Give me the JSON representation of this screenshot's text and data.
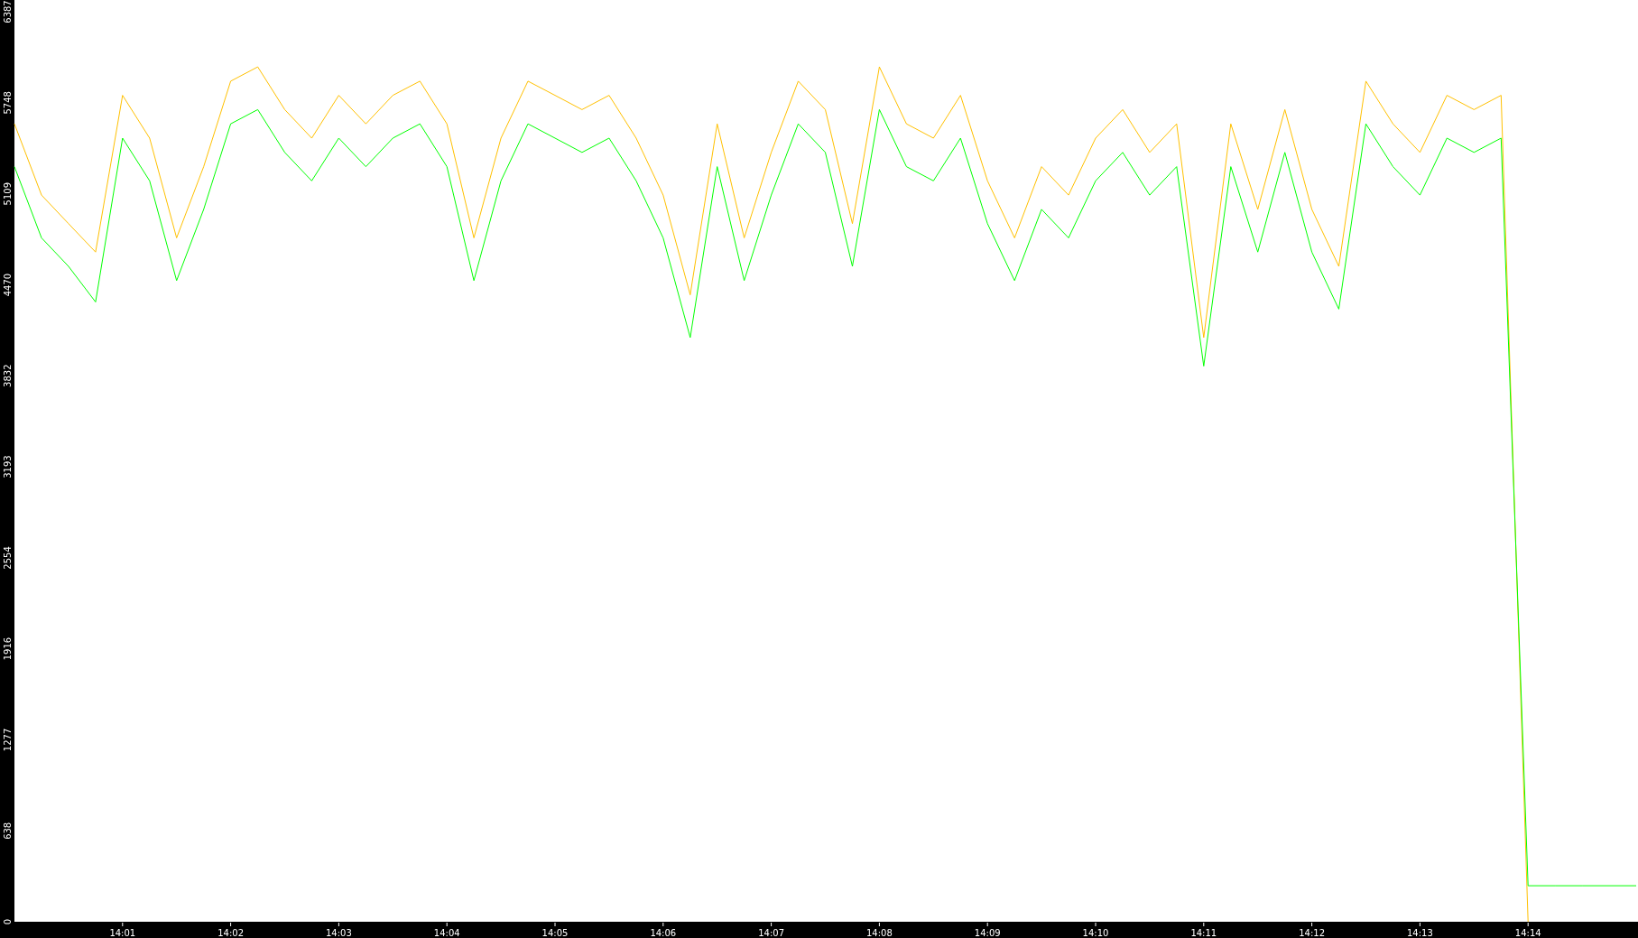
{
  "chart_data": {
    "type": "line",
    "categories": [
      null,
      null,
      null,
      null,
      "14:01",
      null,
      null,
      null,
      "14:02",
      null,
      null,
      null,
      "14:03",
      null,
      null,
      null,
      "14:04",
      null,
      null,
      null,
      "14:05",
      null,
      null,
      null,
      "14:06",
      null,
      null,
      null,
      "14:07",
      null,
      null,
      null,
      "14:08",
      null,
      null,
      null,
      "14:09",
      null,
      null,
      null,
      "14:10",
      null,
      null,
      null,
      "14:11",
      null,
      null,
      null,
      "14:12",
      null,
      null,
      null,
      "14:13",
      null,
      null,
      null,
      "14:14",
      null,
      null,
      null,
      null
    ],
    "series": [
      {
        "color": "#ffc000",
        "values": [
          5600,
          5100,
          4900,
          4700,
          5800,
          5500,
          4800,
          5300,
          5900,
          6000,
          5700,
          5500,
          5800,
          5600,
          5800,
          5900,
          5600,
          4800,
          5500,
          5900,
          5800,
          5700,
          5800,
          5500,
          5100,
          4400,
          5600,
          4800,
          5400,
          5900,
          5700,
          4900,
          6000,
          5600,
          5500,
          5800,
          5200,
          4800,
          5300,
          5100,
          5500,
          5700,
          5400,
          5600,
          4100,
          5600,
          5000,
          5700,
          5000,
          4600,
          5900,
          5600,
          5400,
          5800,
          5700,
          5800,
          0,
          null,
          null,
          null,
          null
        ]
      },
      {
        "color": "#00ff00",
        "values": [
          5300,
          4800,
          4600,
          4350,
          5500,
          5200,
          4500,
          5000,
          5600,
          5700,
          5400,
          5200,
          5500,
          5300,
          5500,
          5600,
          5300,
          4500,
          5200,
          5600,
          5500,
          5400,
          5500,
          5200,
          4800,
          4100,
          5300,
          4500,
          5100,
          5600,
          5400,
          4600,
          5700,
          5300,
          5200,
          5500,
          4900,
          4500,
          5000,
          4800,
          5200,
          5400,
          5100,
          5300,
          3900,
          5300,
          4700,
          5400,
          4700,
          4300,
          5600,
          5300,
          5100,
          5500,
          5400,
          5500,
          253,
          253,
          253,
          253,
          253
        ]
      }
    ],
    "ylim": [
      0,
      6387
    ],
    "yticks": [
      0,
      638,
      1277,
      1916,
      2554,
      3193,
      3832,
      4470,
      5109,
      5748,
      6387
    ]
  }
}
